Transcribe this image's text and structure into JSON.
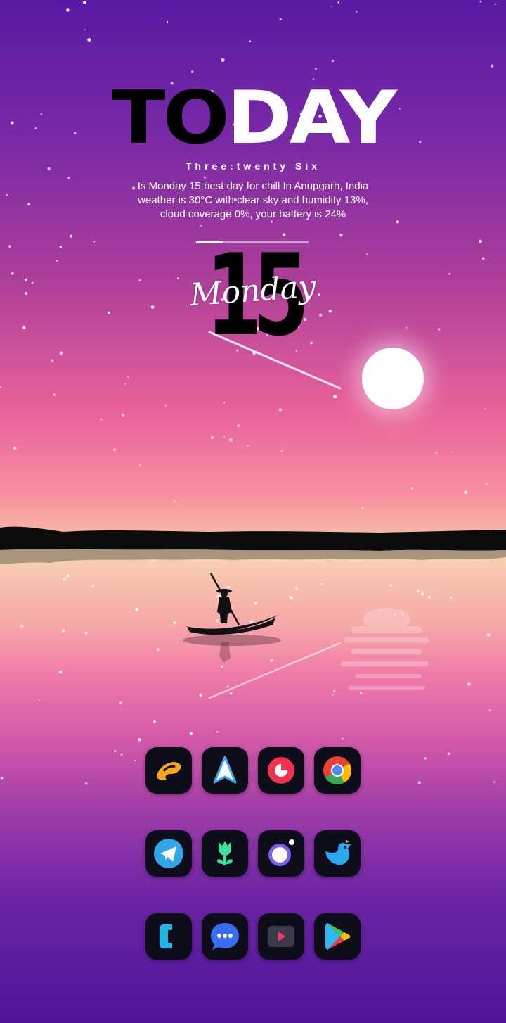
{
  "status_bar": {},
  "widget": {
    "title_dark": "TO",
    "title_light": "DAY",
    "time_words": "Three:twenty Six",
    "description": "Is Monday 15 best day for chill In Anupgarh, India weather is 30°C with clear sky and humidity 13%, cloud coverage 0%, your battery is 24%",
    "battery_percent": 24,
    "day_number": "15",
    "day_name": "Monday"
  },
  "apps": [
    {
      "name": "jiosaavn-icon",
      "color": "#f5a623"
    },
    {
      "name": "arrow-up-icon",
      "color": "#3fa9f5"
    },
    {
      "name": "pie-icon",
      "color": "#f0344e"
    },
    {
      "name": "chrome-icon",
      "color": "#4c8bf5"
    },
    {
      "name": "telegram-icon",
      "color": "#30a6e6"
    },
    {
      "name": "tulip-icon",
      "color": "#3ee0a0"
    },
    {
      "name": "circle-dot-icon",
      "color": "#7b5cf0"
    },
    {
      "name": "bird-icon",
      "color": "#2aa8f0"
    },
    {
      "name": "phone-icon",
      "color": "#20b8e8"
    },
    {
      "name": "chat-bubble-icon",
      "color": "#3a6cf0"
    },
    {
      "name": "video-player-icon",
      "color": "#f03a6a"
    },
    {
      "name": "play-store-icon",
      "color": "#34c759"
    }
  ],
  "colors": {
    "sky_top": "#5a1aa4",
    "horizon": "#f7d2b0",
    "bottom": "#4e149c",
    "icon_bg": "#0e0e1a"
  }
}
